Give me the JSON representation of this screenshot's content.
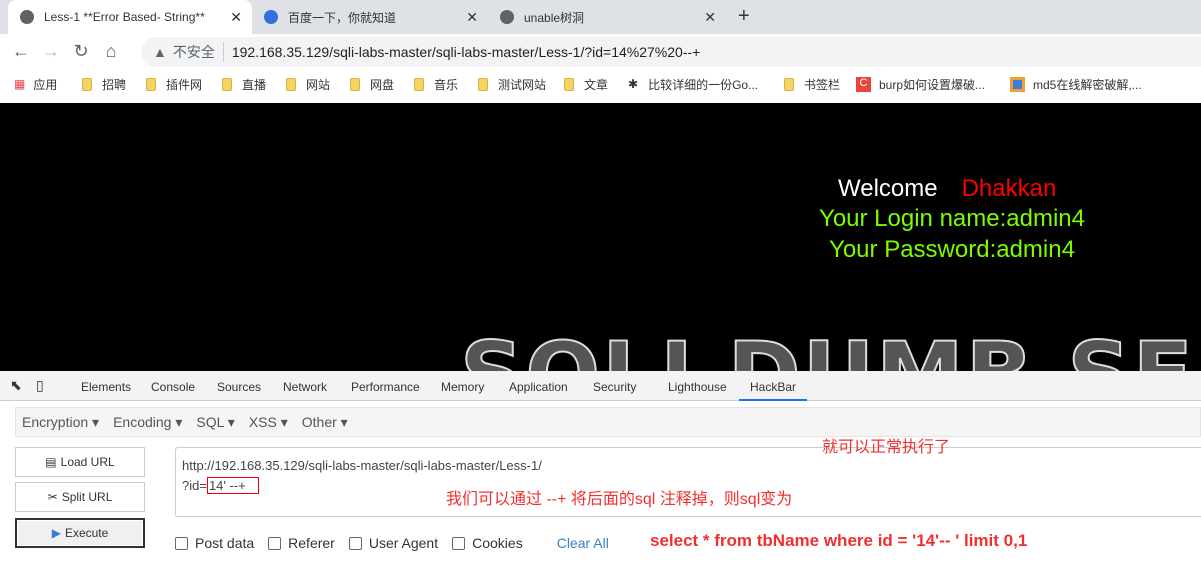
{
  "tabs": [
    {
      "title": "Less-1 **Error Based- String**",
      "active": true
    },
    {
      "title": "百度一下，你就知道"
    },
    {
      "title": "unable树洞"
    }
  ],
  "address": {
    "security": "不安全",
    "url": "192.168.35.129/sqli-labs-master/sqli-labs-master/Less-1/?id=14%27%20--+"
  },
  "bookmarks": [
    "应用",
    "招聘",
    "插件网",
    "直播",
    "网站",
    "网盘",
    "音乐",
    "测试网站",
    "文章",
    "比较详细的一份Go...",
    "书签栏",
    "burp如何设置爆破...",
    "md5在线解密破解,..."
  ],
  "page": {
    "welcome": "Welcome",
    "name": "Dhakkan",
    "login": "Your Login name:admin4",
    "password": "Your Password:admin4",
    "logo": "SQLI DUMB SERIES"
  },
  "devtools": {
    "tabs": [
      "Elements",
      "Console",
      "Sources",
      "Network",
      "Performance",
      "Memory",
      "Application",
      "Security",
      "Lighthouse",
      "HackBar"
    ],
    "active": "HackBar"
  },
  "hackbar": {
    "menus": [
      "Encryption",
      "Encoding",
      "SQL",
      "XSS",
      "Other"
    ],
    "buttons": {
      "load": "Load URL",
      "split": "Split URL",
      "execute": "Execute"
    },
    "url_line1": "http://192.168.35.129/sqli-labs-master/sqli-labs-master/Less-1/",
    "url_prefix": "?id=",
    "url_highlight": "14' --+",
    "options": [
      "Post data",
      "Referer",
      "User Agent",
      "Cookies"
    ],
    "clear": "Clear All"
  },
  "annotations": {
    "a1": "就可以正常执行了",
    "a2": "我们可以通过 --+ 将后面的sql 注释掉，则sql变为",
    "a3": "select * from tbName where id = '14'-- ' limit 0,1"
  }
}
